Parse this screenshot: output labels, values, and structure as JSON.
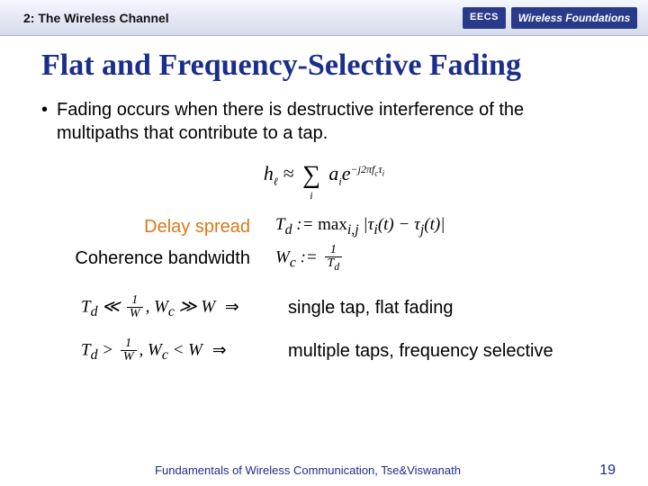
{
  "header": {
    "chapter": "2: The Wireless Channel",
    "logo_eecs": "EECS",
    "logo_wf": "Wireless Foundations"
  },
  "title": "Flat and Frequency-Selective Fading",
  "bullet": "Fading occurs when there is destructive interference of the multipaths that contribute to a tap.",
  "formula_main": {
    "lhs": "h",
    "lhs_sub": "ℓ",
    "approx": "≈",
    "sum_symbol": "∑",
    "sum_index": "i",
    "coeff": "a",
    "coeff_sub": "i",
    "exp_base": "e",
    "exp_sup": "−j2πf_c τ_i"
  },
  "defs": {
    "delay_label": "Delay spread",
    "delay_formula": "T_d := max_{i,j} |τ_i(t) − τ_j(t)|",
    "coh_label": "Coherence bandwidth",
    "coh_formula_lhs": "W_c :=",
    "coh_frac_num": "1",
    "coh_frac_den": "T_d"
  },
  "cases": {
    "flat_math": "T_d ≪ 1/W, W_c ≫ W ⇒",
    "flat_text": "single tap, flat fading",
    "sel_math": "T_d > 1/W, W_c < W ⇒",
    "sel_text": "multiple taps, frequency selective"
  },
  "footer": {
    "text": "Fundamentals of Wireless Communication, Tse&Viswanath",
    "page": "19"
  }
}
